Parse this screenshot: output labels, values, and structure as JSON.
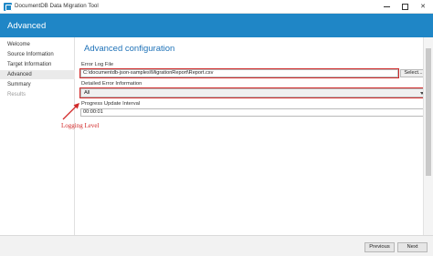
{
  "window": {
    "title": "DocumentDB Data Migration Tool",
    "controls": {
      "minimize_icon": "minimize-icon",
      "maximize_icon": "maximize-icon",
      "close_glyph": "✕"
    }
  },
  "header": {
    "title": "Advanced"
  },
  "sidebar": {
    "items": [
      {
        "label": "Welcome",
        "state": "normal"
      },
      {
        "label": "Source Information",
        "state": "normal"
      },
      {
        "label": "Target Information",
        "state": "normal"
      },
      {
        "label": "Advanced",
        "state": "active"
      },
      {
        "label": "Summary",
        "state": "normal"
      },
      {
        "label": "Results",
        "state": "disabled"
      }
    ]
  },
  "main": {
    "title": "Advanced configuration",
    "error_log": {
      "label": "Error Log File",
      "value": "C:\\documentdb-json-samples\\MigrationReport\\Report.csv",
      "select_button": "Select..."
    },
    "detailed_error": {
      "label": "Detailed Error Information",
      "selected": "All"
    },
    "progress_interval": {
      "label": "Progress Update Interval",
      "value": "00:00:01"
    }
  },
  "annotation": {
    "text": "Logging Level",
    "color": "#d22a2a"
  },
  "footer": {
    "previous": "Previous",
    "next": "Next"
  },
  "colors": {
    "accent": "#1f86c6",
    "highlight": "#d02a2a"
  }
}
